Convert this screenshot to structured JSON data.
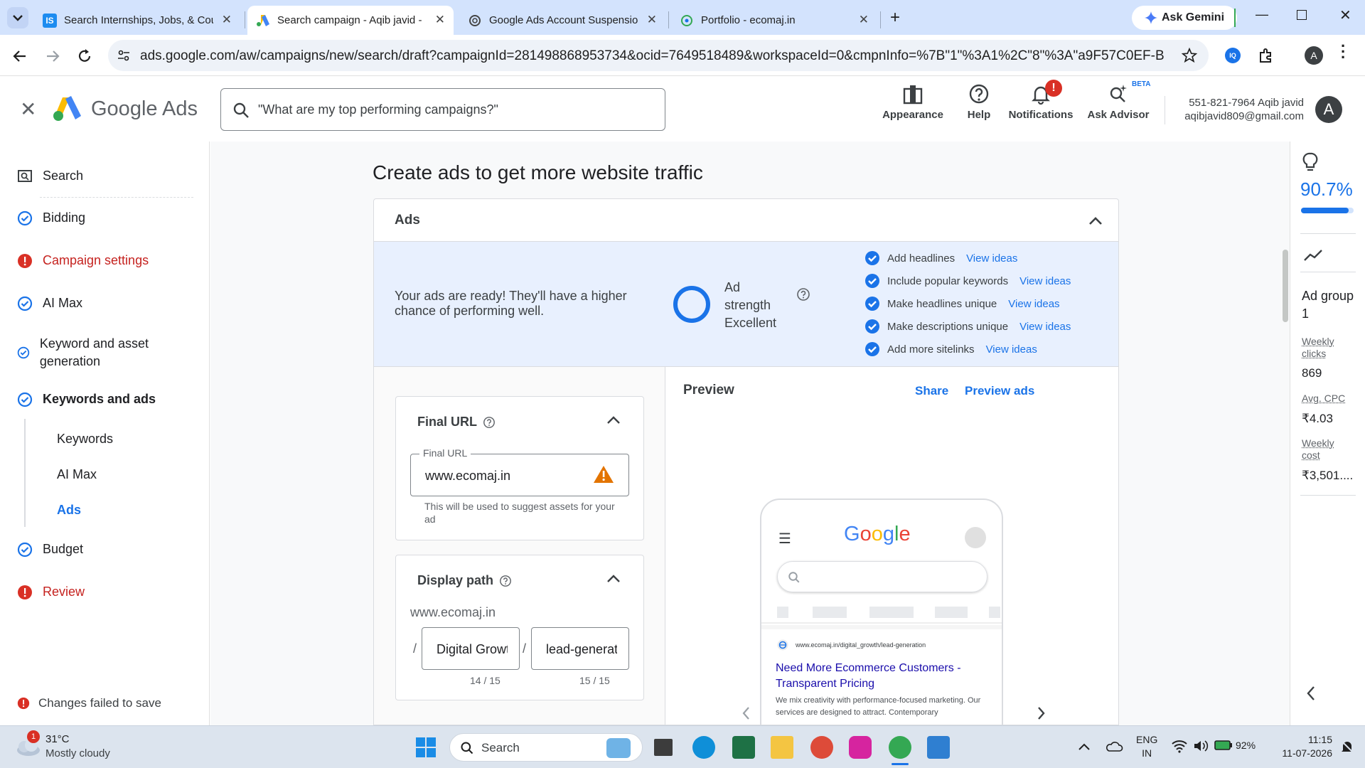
{
  "browser": {
    "tabs": [
      {
        "title": "Search Internships, Jobs, & Cou",
        "icon": "internshala-icon"
      },
      {
        "title": "Search campaign - Aqib javid -",
        "icon": "google-ads-icon",
        "active": true
      },
      {
        "title": "Google Ads Account Suspensio",
        "icon": "openai-icon"
      },
      {
        "title": "Portfolio - ecomaj.in",
        "icon": "portfolio-icon"
      }
    ],
    "ask_gemini": "Ask Gemini",
    "url": "ads.google.com/aw/campaigns/new/search/draft?campaignId=281498868953734&ocid=7649518489&workspaceId=0&cmpnInfo=%7B\"1\"%3A1%2C\"8\"%3A\"a9F57C0EF-B866-4EFA-87EB...",
    "profile_initial": "A"
  },
  "header": {
    "brand": "Google Ads",
    "search_placeholder": "\"What are my top performing campaigns?\"",
    "buttons": {
      "appearance": "Appearance",
      "help": "Help",
      "notifications": "Notifications",
      "notifications_badge": "!",
      "ask_advisor": "Ask Advisor",
      "beta": "BETA"
    },
    "account_line1": "551-821-7964 Aqib javid",
    "account_line2": "aqibjavid809@gmail.com",
    "avatar": "A"
  },
  "nav": {
    "items": [
      {
        "label": "Search",
        "status": "search"
      },
      {
        "label": "Bidding",
        "status": "done"
      },
      {
        "label": "Campaign settings",
        "status": "error"
      },
      {
        "label": "AI Max",
        "status": "done"
      },
      {
        "label": "Keyword and asset generation",
        "status": "done"
      },
      {
        "label": "Keywords and ads",
        "status": "done"
      },
      {
        "label": "Budget",
        "status": "done"
      },
      {
        "label": "Review",
        "status": "error"
      }
    ],
    "subitems": [
      "Keywords",
      "AI Max",
      "Ads"
    ],
    "footer": "Changes failed to save"
  },
  "main": {
    "title": "Create ads to get more website traffic",
    "card_title": "Ads",
    "ready_text": "Your ads are ready! They'll have a higher chance of performing well.",
    "strength_label": "Ad strength",
    "strength_value": "Excellent",
    "checklist": [
      {
        "label": "Add headlines",
        "link": "View ideas"
      },
      {
        "label": "Include popular keywords",
        "link": "View ideas"
      },
      {
        "label": "Make headlines unique",
        "link": "View ideas"
      },
      {
        "label": "Make descriptions unique",
        "link": "View ideas"
      },
      {
        "label": "Add more sitelinks",
        "link": "View ideas"
      }
    ],
    "final_url": {
      "title": "Final URL",
      "field_label": "Final URL",
      "value": "www.ecomaj.in",
      "hint": "This will be used to suggest assets for your ad"
    },
    "display_path": {
      "title": "Display path",
      "base": "www.ecomaj.in",
      "sep": "/",
      "path1": "Digital Growth",
      "path2": "lead-generation",
      "count1": "14 / 15",
      "count2": "15 / 15"
    },
    "preview": {
      "title": "Preview",
      "share": "Share",
      "preview_ads": "Preview ads",
      "google_logo": "Google",
      "ad_url": "www.ecomaj.in/digital_growth/lead-generation",
      "ad_headline": "Need More Ecommerce Customers - Transparent Pricing",
      "ad_desc": "We mix creativity with performance-focused marketing. Our services are designed to attract. Contemporary"
    }
  },
  "right_panel": {
    "score": "90.7%",
    "score_fraction": 0.907,
    "group": "Ad group 1",
    "weekly_clicks_label": "Weekly clicks",
    "weekly_clicks": "869",
    "avg_cpc_label": "Avg. CPC",
    "avg_cpc": "₹4.03",
    "weekly_cost_label": "Weekly cost",
    "weekly_cost": "₹3,501...."
  },
  "taskbar": {
    "weather_temp": "31°C",
    "weather_desc": "Mostly cloudy",
    "weather_badge": "1",
    "search": "Search",
    "lang1": "ENG",
    "lang2": "IN",
    "battery": "92%",
    "time": "11:15",
    "date": "11-07-2026"
  }
}
